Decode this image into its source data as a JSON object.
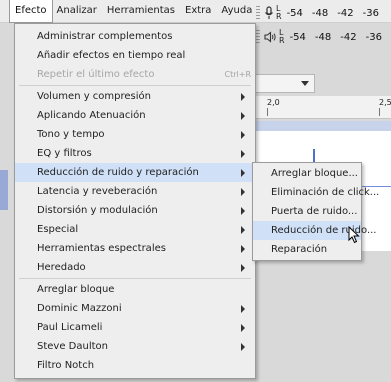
{
  "menubar": {
    "items": [
      "Efecto",
      "Analizar",
      "Herramientas",
      "Extra",
      "Ayuda"
    ],
    "active_index": 0
  },
  "meters": {
    "rec_scale": [
      "-54",
      "-48",
      "-42",
      "-36"
    ],
    "play_scale": [
      "-54",
      "-48",
      "-42",
      "-36"
    ],
    "lr_top": "L",
    "lr_bottom": "R"
  },
  "ghost": {
    "edge_letter": "E",
    "ctrl_r": "Ctrl+R"
  },
  "ruler": {
    "labels": [
      "2,0",
      "2,5"
    ]
  },
  "menu": {
    "items": [
      {
        "label": "Administrar complementos",
        "submenu": false,
        "disabled": false
      },
      {
        "label": "Añadir efectos en tiempo real",
        "submenu": false,
        "disabled": false
      },
      {
        "label": "Repetir el último efecto",
        "submenu": false,
        "disabled": true,
        "shortcut": "Ctrl+R"
      },
      {
        "label": "Volumen y compresión",
        "submenu": true,
        "disabled": false
      },
      {
        "label": "Aplicando Atenuación",
        "submenu": true,
        "disabled": false
      },
      {
        "label": "Tono y tempo",
        "submenu": true,
        "disabled": false
      },
      {
        "label": "EQ y filtros",
        "submenu": true,
        "disabled": false
      },
      {
        "label": "Reducción de ruido y reparación",
        "submenu": true,
        "disabled": false,
        "highlighted": true
      },
      {
        "label": "Latencia y reveberación",
        "submenu": true,
        "disabled": false
      },
      {
        "label": "Distorsión y modulación",
        "submenu": true,
        "disabled": false
      },
      {
        "label": "Especial",
        "submenu": true,
        "disabled": false
      },
      {
        "label": "Herramientas espectrales",
        "submenu": true,
        "disabled": false
      },
      {
        "label": "Heredado",
        "submenu": true,
        "disabled": false
      },
      {
        "label": "Arreglar bloque",
        "submenu": false,
        "disabled": false
      },
      {
        "label": "Dominic Mazzoni",
        "submenu": true,
        "disabled": false
      },
      {
        "label": "Paul Licameli",
        "submenu": true,
        "disabled": false
      },
      {
        "label": "Steve Daulton",
        "submenu": true,
        "disabled": false
      },
      {
        "label": "Filtro Notch",
        "submenu": false,
        "disabled": false
      }
    ]
  },
  "submenu": {
    "items": [
      {
        "label": "Arreglar bloque..."
      },
      {
        "label": "Eliminación de click..."
      },
      {
        "label": "Puerta de ruido..."
      },
      {
        "label": "Reducción de ruido...",
        "highlighted": true
      },
      {
        "label": "Reparación"
      }
    ]
  },
  "colors": {
    "highlight": "#cfe0f7",
    "menu_bg": "#eeeeee",
    "wave": "#3b5cc7"
  }
}
